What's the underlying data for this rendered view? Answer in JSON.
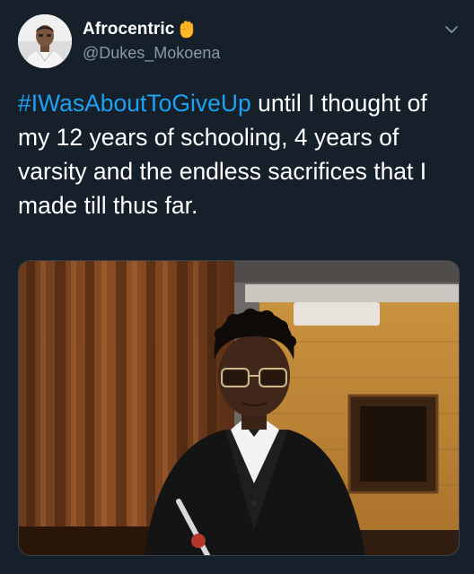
{
  "author": {
    "display_name": "Afrocentric",
    "handle": "@Dukes_Mokoena",
    "badge_icon": "raised-fist-icon"
  },
  "tweet": {
    "hashtag": "#IWasAboutToGiveUp",
    "text": " until I thought of my 12 years of schooling, 4 years of varsity and the endless sacrifices that I made till thus far."
  },
  "colors": {
    "background": "#15202b",
    "link": "#1da1f2",
    "secondary_text": "#8899a6"
  },
  "icons": {
    "menu": "chevron-down-icon"
  }
}
